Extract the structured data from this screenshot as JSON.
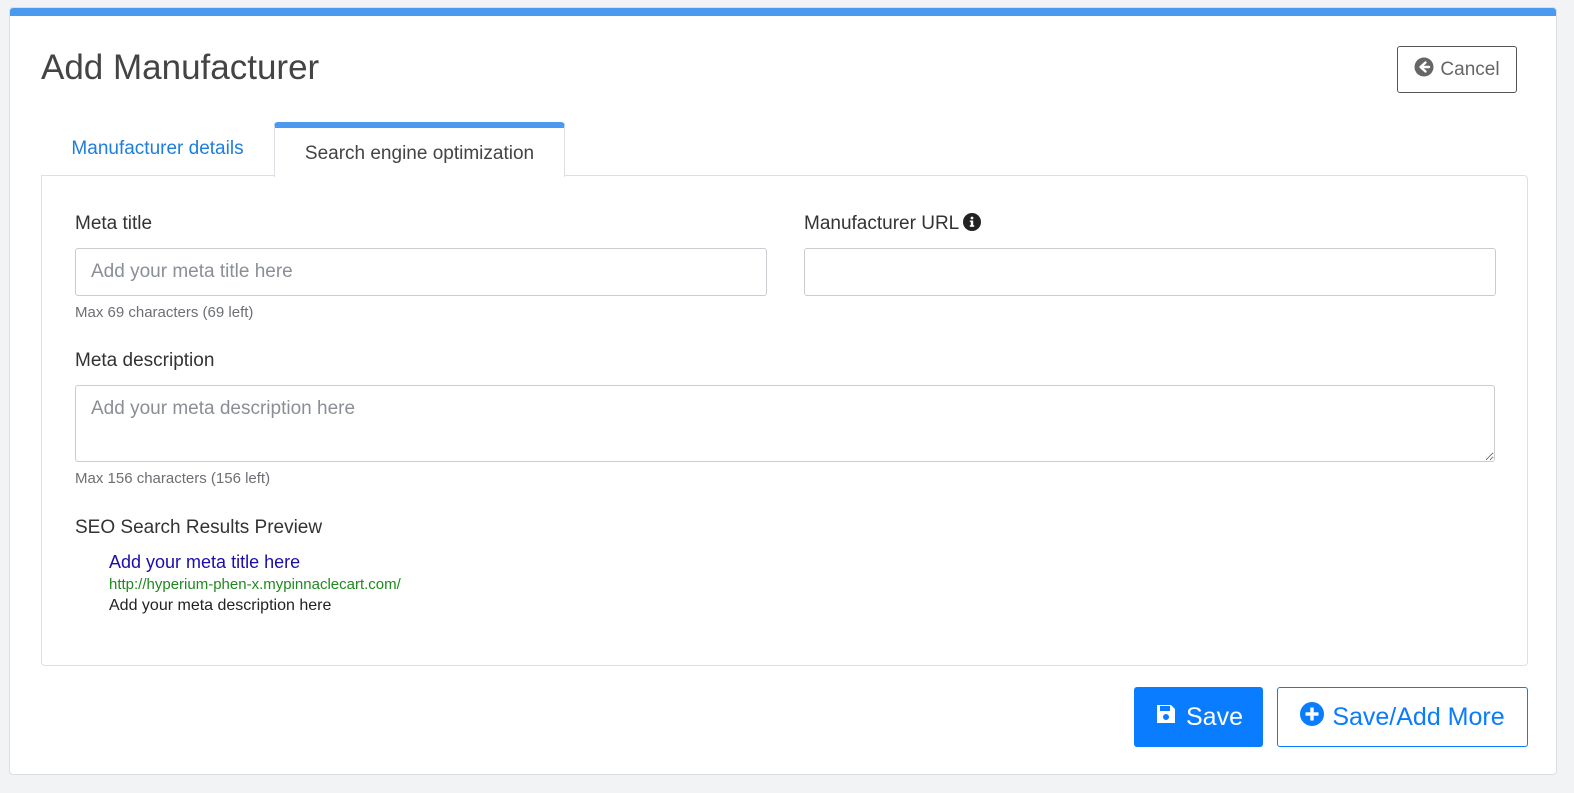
{
  "page": {
    "title": "Add Manufacturer"
  },
  "header": {
    "cancel_label": "Cancel",
    "cancel_icon": "arrow-circle-left-icon"
  },
  "tabs": [
    {
      "label": "Manufacturer details",
      "active": false
    },
    {
      "label": "Search engine optimization",
      "active": true
    }
  ],
  "form": {
    "meta_title": {
      "label": "Meta title",
      "value": "",
      "placeholder": "Add your meta title here",
      "hint": "Max 69 characters (69 left)"
    },
    "manufacturer_url": {
      "label": "Manufacturer URL",
      "value": "",
      "placeholder": "",
      "info_icon": "info-circle-icon"
    },
    "meta_description": {
      "label": "Meta description",
      "value": "",
      "placeholder": "Add your meta description here",
      "hint": "Max 156 characters (156 left)"
    }
  },
  "seo_preview": {
    "heading": "SEO Search Results Preview",
    "title": "Add your meta title here",
    "url": "http://hyperium-phen-x.mypinnaclecart.com/",
    "description": "Add your meta description here"
  },
  "actions": {
    "save_label": "Save",
    "save_icon": "floppy-disk-icon",
    "save_more_label": "Save/Add More",
    "save_more_icon": "plus-circle-icon"
  },
  "colors": {
    "accent": "#4a9af0",
    "primary": "#0a7cff",
    "link": "#1e7de0",
    "seo_title": "#1a0dab",
    "seo_url": "#1e8a1e"
  }
}
